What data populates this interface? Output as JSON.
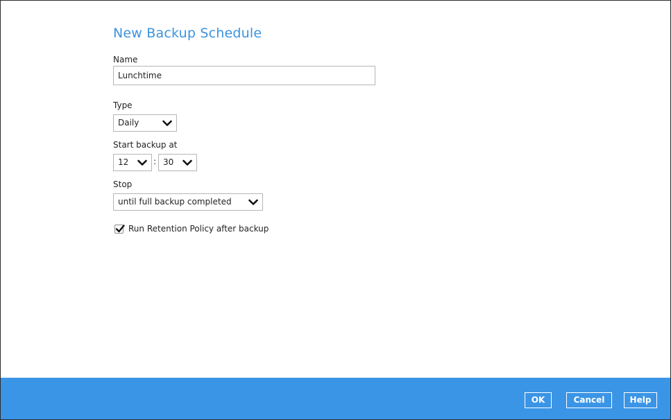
{
  "dialog": {
    "title": "New Backup Schedule"
  },
  "name_field": {
    "label": "Name",
    "value": "Lunchtime"
  },
  "type_field": {
    "label": "Type",
    "selected": "Daily"
  },
  "start_backup": {
    "label": "Start backup at",
    "hour": "12",
    "separator": ":",
    "minute": "30"
  },
  "stop_field": {
    "label": "Stop",
    "selected": "until full backup completed"
  },
  "retention": {
    "label": "Run Retention Policy after backup",
    "checked": true
  },
  "footer": {
    "ok_label": "OK",
    "cancel_label": "Cancel",
    "help_label": "Help"
  },
  "colors": {
    "accent": "#3c93df",
    "footer_bar": "#3b95e6"
  },
  "icons": {
    "dropdown": "chevron-down-icon",
    "check": "checkmark-icon"
  }
}
